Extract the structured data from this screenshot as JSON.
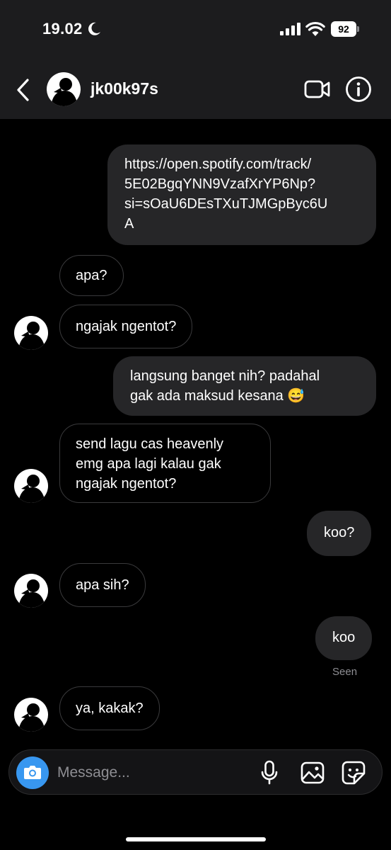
{
  "status_bar": {
    "time": "19.02",
    "battery": "92"
  },
  "header": {
    "username": "jk00k97s",
    "back_icon": "chevron-left-icon",
    "call_icon": "video-camera-icon",
    "info_icon": "info-icon"
  },
  "messages": [
    {
      "direction": "out",
      "lines": [
        "https://open.spotify.com/track/",
        "5E02BgqYNN9VzafXrYP6Np?",
        "si=sOaU6DEsTXuTJMGpByc6U",
        "A"
      ]
    },
    {
      "direction": "in",
      "lines": [
        "apa?"
      ]
    },
    {
      "direction": "in",
      "lines": [
        "ngajak ngentot?"
      ]
    },
    {
      "direction": "out",
      "lines": [
        "langsung banget nih? padahal",
        "gak ada maksud kesana 😅"
      ]
    },
    {
      "direction": "in",
      "lines": [
        "send lagu cas heavenly",
        "emg apa lagi kalau gak",
        "ngajak ngentot?"
      ]
    },
    {
      "direction": "out",
      "lines": [
        "koo?"
      ]
    },
    {
      "direction": "in",
      "lines": [
        "apa sih?"
      ]
    },
    {
      "direction": "out",
      "lines": [
        "koo"
      ]
    },
    {
      "direction": "in",
      "lines": [
        "ya, kakak?"
      ]
    }
  ],
  "seen_label": "Seen",
  "composer": {
    "placeholder": "Message...",
    "camera_icon": "camera-icon",
    "mic_icon": "microphone-icon",
    "gallery_icon": "image-gallery-icon",
    "sticker_icon": "sticker-icon"
  },
  "colors": {
    "accent": "#3897f0",
    "outgoing_bubble": "#262628",
    "incoming_border": "#3a3a3c",
    "background": "#000000",
    "header": "#1c1c1e"
  }
}
